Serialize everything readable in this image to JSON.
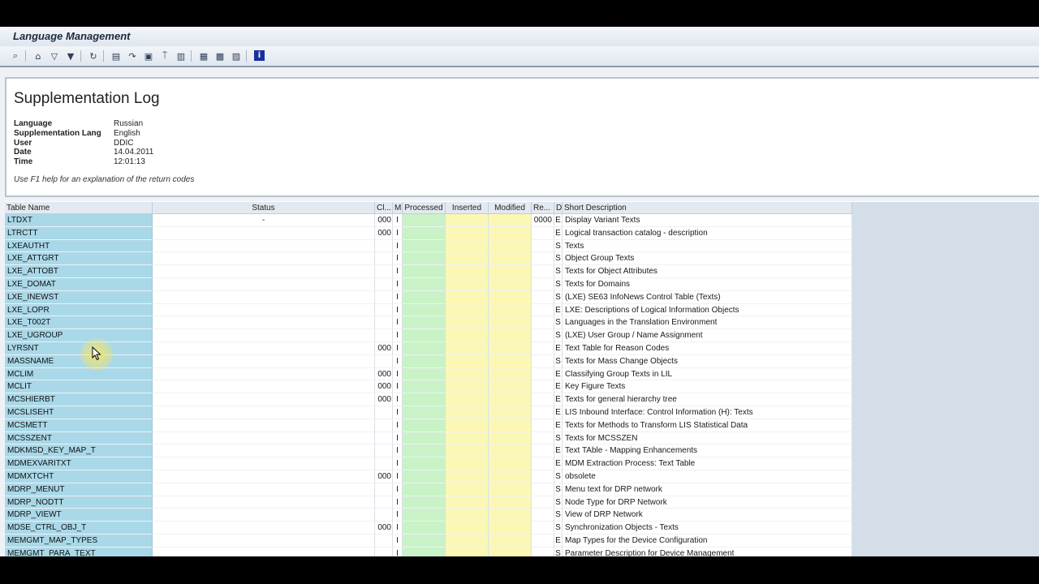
{
  "window": {
    "title": "Language Management"
  },
  "toolbar": {
    "buttons": [
      "refresh",
      "print",
      "filter",
      "filter-set",
      "find",
      "export",
      "send",
      "download",
      "copy",
      "layout",
      "change-layout",
      "spreadsheet",
      "detail",
      "info"
    ]
  },
  "header": {
    "title": "Supplementation Log",
    "fields": [
      {
        "label": "Language",
        "value": "Russian"
      },
      {
        "label": "Supplementation Lang",
        "value": "English"
      },
      {
        "label": "User",
        "value": "DDIC"
      },
      {
        "label": "Date",
        "value": "14.04.2011"
      },
      {
        "label": "Time",
        "value": "12:01:13"
      }
    ],
    "note": "Use F1 help for an explanation of the return codes"
  },
  "table": {
    "columns": {
      "name": "Table Name",
      "status": "Status",
      "cl": "Cl...",
      "m": "M",
      "processed": "Processed",
      "inserted": "Inserted",
      "modified": "Modified",
      "re": "Re...",
      "d": "D",
      "desc": "Short Description"
    },
    "rows": [
      {
        "name": "LTDXT",
        "status": "-",
        "cl": "000",
        "m": "I",
        "re": "0000",
        "d": "E",
        "desc": "Display Variant Texts"
      },
      {
        "name": "LTRCTT",
        "status": "",
        "cl": "000",
        "m": "I",
        "re": "",
        "d": "E",
        "desc": "Logical transaction catalog - description"
      },
      {
        "name": "LXEAUTHT",
        "status": "",
        "cl": "",
        "m": "I",
        "re": "",
        "d": "S",
        "desc": "Texts"
      },
      {
        "name": "LXE_ATTGRT",
        "status": "",
        "cl": "",
        "m": "I",
        "re": "",
        "d": "S",
        "desc": "Object Group Texts"
      },
      {
        "name": "LXE_ATTOBT",
        "status": "",
        "cl": "",
        "m": "I",
        "re": "",
        "d": "S",
        "desc": "Texts for Object Attributes"
      },
      {
        "name": "LXE_DOMAT",
        "status": "",
        "cl": "",
        "m": "I",
        "re": "",
        "d": "S",
        "desc": "Texts for Domains"
      },
      {
        "name": "LXE_INEWST",
        "status": "",
        "cl": "",
        "m": "I",
        "re": "",
        "d": "S",
        "desc": "(LXE) SE63 InfoNews Control Table (Texts)"
      },
      {
        "name": "LXE_LOPR",
        "status": "",
        "cl": "",
        "m": "I",
        "re": "",
        "d": "E",
        "desc": "LXE: Descriptions of Logical Information Objects"
      },
      {
        "name": "LXE_T002T",
        "status": "",
        "cl": "",
        "m": "I",
        "re": "",
        "d": "S",
        "desc": "Languages in the Translation Environment"
      },
      {
        "name": "LXE_UGROUP",
        "status": "",
        "cl": "",
        "m": "I",
        "re": "",
        "d": "S",
        "desc": "(LXE) User Group / Name Assignment"
      },
      {
        "name": "LYRSNT",
        "status": "",
        "cl": "000",
        "m": "I",
        "re": "",
        "d": "E",
        "desc": "Text Table for Reason Codes"
      },
      {
        "name": "MASSNAME",
        "status": "",
        "cl": "",
        "m": "I",
        "re": "",
        "d": "S",
        "desc": "Texts for Mass Change Objects"
      },
      {
        "name": "MCLIM",
        "status": "",
        "cl": "000",
        "m": "I",
        "re": "",
        "d": "E",
        "desc": "Classifying Group Texts in LIL"
      },
      {
        "name": "MCLIT",
        "status": "",
        "cl": "000",
        "m": "I",
        "re": "",
        "d": "E",
        "desc": "Key Figure Texts"
      },
      {
        "name": "MCSHIERBT",
        "status": "",
        "cl": "000",
        "m": "I",
        "re": "",
        "d": "E",
        "desc": "Texts for general hierarchy tree"
      },
      {
        "name": "MCSLISEHT",
        "status": "",
        "cl": "",
        "m": "I",
        "re": "",
        "d": "E",
        "desc": "LIS Inbound Interface: Control Information (H): Texts"
      },
      {
        "name": "MCSMETT",
        "status": "",
        "cl": "",
        "m": "I",
        "re": "",
        "d": "E",
        "desc": "Texts for Methods to Transform LIS Statistical Data"
      },
      {
        "name": "MCSSZENT",
        "status": "",
        "cl": "",
        "m": "I",
        "re": "",
        "d": "S",
        "desc": "Texts for MCSSZEN"
      },
      {
        "name": "MDKMSD_KEY_MAP_T",
        "status": "",
        "cl": "",
        "m": "I",
        "re": "",
        "d": "E",
        "desc": "Text TAble - Mapping Enhancements"
      },
      {
        "name": "MDMEXVARITXT",
        "status": "",
        "cl": "",
        "m": "I",
        "re": "",
        "d": "E",
        "desc": "MDM Extraction Process: Text Table"
      },
      {
        "name": "MDMXTCHT",
        "status": "",
        "cl": "000",
        "m": "I",
        "re": "",
        "d": "S",
        "desc": "obsolete"
      },
      {
        "name": "MDRP_MENUT",
        "status": "",
        "cl": "",
        "m": "I",
        "re": "",
        "d": "S",
        "desc": "Menu text for DRP network"
      },
      {
        "name": "MDRP_NODTT",
        "status": "",
        "cl": "",
        "m": "I",
        "re": "",
        "d": "S",
        "desc": "Node Type for DRP Network"
      },
      {
        "name": "MDRP_VIEWT",
        "status": "",
        "cl": "",
        "m": "I",
        "re": "",
        "d": "S",
        "desc": "View of DRP Network"
      },
      {
        "name": "MDSE_CTRL_OBJ_T",
        "status": "",
        "cl": "000",
        "m": "I",
        "re": "",
        "d": "S",
        "desc": "Synchronization Objects - Texts"
      },
      {
        "name": "MEMGMT_MAP_TYPES",
        "status": "",
        "cl": "",
        "m": "I",
        "re": "",
        "d": "E",
        "desc": "Map Types for the Device Configuration"
      },
      {
        "name": "MEMGMT_PARA_TEXT",
        "status": "",
        "cl": "",
        "m": "I",
        "re": "",
        "d": "S",
        "desc": "Parameter Description for Device Management"
      }
    ]
  }
}
